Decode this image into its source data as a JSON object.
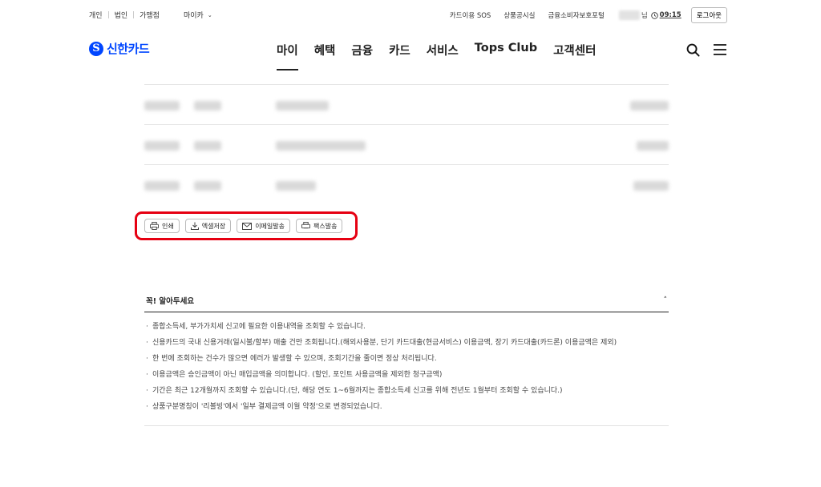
{
  "util_left": {
    "personal": "개인",
    "corporate": "법인",
    "merchant": "가맹점",
    "mycard": "마이카"
  },
  "util_right": {
    "links": [
      "카드이용 SOS",
      "상품공시실",
      "금융소비자보호포털"
    ],
    "user_suffix": "님",
    "time": "09:15",
    "logout": "로그아웃"
  },
  "logo": {
    "mark": "S",
    "text": "신한카드"
  },
  "nav": [
    "마이",
    "혜택",
    "금융",
    "카드",
    "서비스",
    "Tops Club",
    "고객센터"
  ],
  "actions": {
    "print": "인쇄",
    "excel": "엑셀저장",
    "email": "이메일발송",
    "fax": "팩스발송"
  },
  "notice": {
    "title": "꼭! 알아두세요",
    "toggle": "˄",
    "items": [
      "종합소득세, 부가가치세 신고에 필요한 이용내역을 조회할 수 있습니다.",
      "신용카드의 국내 신용거래(일시불/할부) 매출 건만 조회됩니다.(해외사용분, 단기 카드대출(현금서비스) 이용금액, 장기 카드대출(카드론) 이용금액은 제외)",
      "한 번에 조회하는 건수가 많으면 에러가 발생할 수 있으며, 조회기간을 줄이면 정상 처리됩니다.",
      "이용금액은 승인금액이 아닌 매입금액을 의미합니다. (할인, 포인트 사용금액을 제외한 청구금액)",
      "기간은 최근 12개월까지 조회할 수 있습니다.(단, 해당 연도 1~6월까지는 종합소득세 신고를 위해 전년도 1월부터 조회할 수 있습니다.)",
      "상품구분명칭이 '리볼빙'에서 '일부 결제금액 이월 약정'으로 변경되었습니다."
    ]
  },
  "colors": {
    "brand": "#0046ff",
    "highlight": "#e60012"
  }
}
